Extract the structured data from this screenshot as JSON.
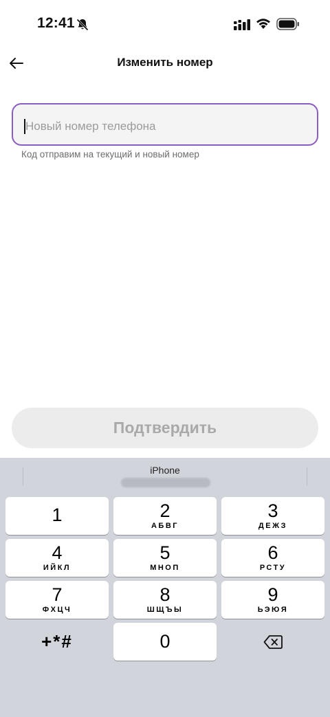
{
  "status_bar": {
    "time": "12:41"
  },
  "header": {
    "title": "Изменить номер"
  },
  "phone_field": {
    "placeholder": "Новый номер телефона",
    "value": ""
  },
  "hint": "Код отправим на текущий и новый номер",
  "confirm_button": {
    "label": "Подтвердить",
    "enabled": false
  },
  "keyboard": {
    "source_label": "iPhone",
    "keys": [
      {
        "digit": "1",
        "letters": ""
      },
      {
        "digit": "2",
        "letters": "АБВГ"
      },
      {
        "digit": "3",
        "letters": "ДЕЖЗ"
      },
      {
        "digit": "4",
        "letters": "ИЙКЛ"
      },
      {
        "digit": "5",
        "letters": "МНОП"
      },
      {
        "digit": "6",
        "letters": "РСТУ"
      },
      {
        "digit": "7",
        "letters": "ФХЦЧ"
      },
      {
        "digit": "8",
        "letters": "ШЩЪЫ"
      },
      {
        "digit": "9",
        "letters": "ЬЭЮЯ"
      },
      {
        "digit": "0",
        "letters": ""
      }
    ],
    "symbols_label": "+*#"
  },
  "colors": {
    "accent_border": "#8a5cc2",
    "keyboard_bg": "#d2d4dc",
    "disabled_button_bg": "#ececec",
    "disabled_button_text": "#a9a9a9"
  },
  "icons": [
    "bell-off-icon",
    "signal-icon",
    "wifi-icon",
    "battery-icon",
    "back-arrow-icon",
    "backspace-icon"
  ]
}
